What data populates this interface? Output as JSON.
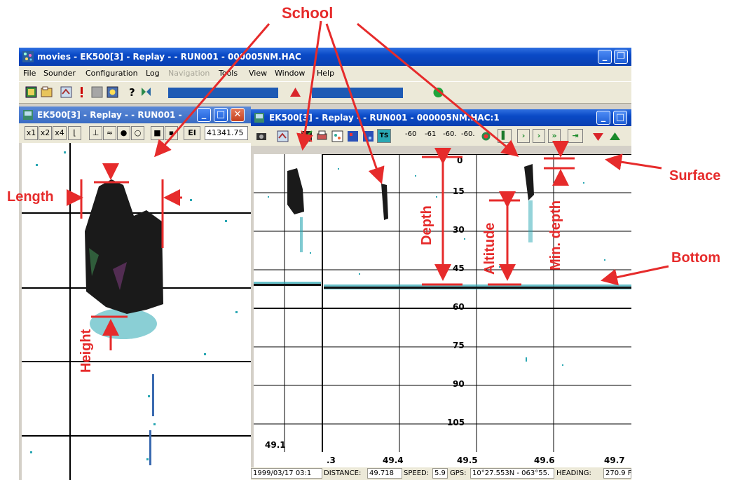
{
  "main_window": {
    "title": "movies - EK500[3] - Replay -  - RUN001 - 000005NM.HAC",
    "menu": [
      "File",
      "Sounder",
      "Configuration",
      "Log",
      "Navigation",
      "Tools",
      "View",
      "Window",
      "Help"
    ],
    "disabled_menu": "Navigation"
  },
  "left_window": {
    "title": "EK500[3] - Replay -  - RUN001 -",
    "zoom_buttons": [
      "x1",
      "x2",
      "x4"
    ],
    "ei_label": "EI",
    "readout": "41341.75",
    "bottom_value": "49.1"
  },
  "right_window": {
    "title": "EK500[3] - Replay -  - RUN001 - 000005NM.HAC:1",
    "ts_label": "TS",
    "header_values": [
      "-60",
      "-61",
      "-60.",
      "-60."
    ],
    "depth_ticks": [
      "0",
      "15",
      "30",
      "45",
      "60",
      "75",
      "90",
      "105"
    ],
    "distance_ticks": [
      ".3",
      "49.4",
      "49.5",
      "49.6",
      "49.7"
    ]
  },
  "status_bar": {
    "datetime": "1999/03/17 03:1",
    "distance_label": "DISTANCE:",
    "distance": "49.718",
    "speed_label": "SPEED:",
    "speed": "5.9",
    "gps_label": "GPS:",
    "gps": "10°27.553N - 063°55.",
    "heading_label": "HEADING:",
    "heading": "270.9 F"
  },
  "annotations": {
    "school": "School",
    "surface": "Surface",
    "bottom": "Bottom",
    "length": "Length",
    "height": "Height",
    "depth": "Depth",
    "altitude": "Altitude",
    "min_depth": "Min. depth"
  },
  "colors": {
    "annotation": "#e62b2b",
    "title_bar": "#0a4ac6",
    "echo_dark": "#1a1a1a",
    "echo_teal": "#2aa7b3"
  }
}
